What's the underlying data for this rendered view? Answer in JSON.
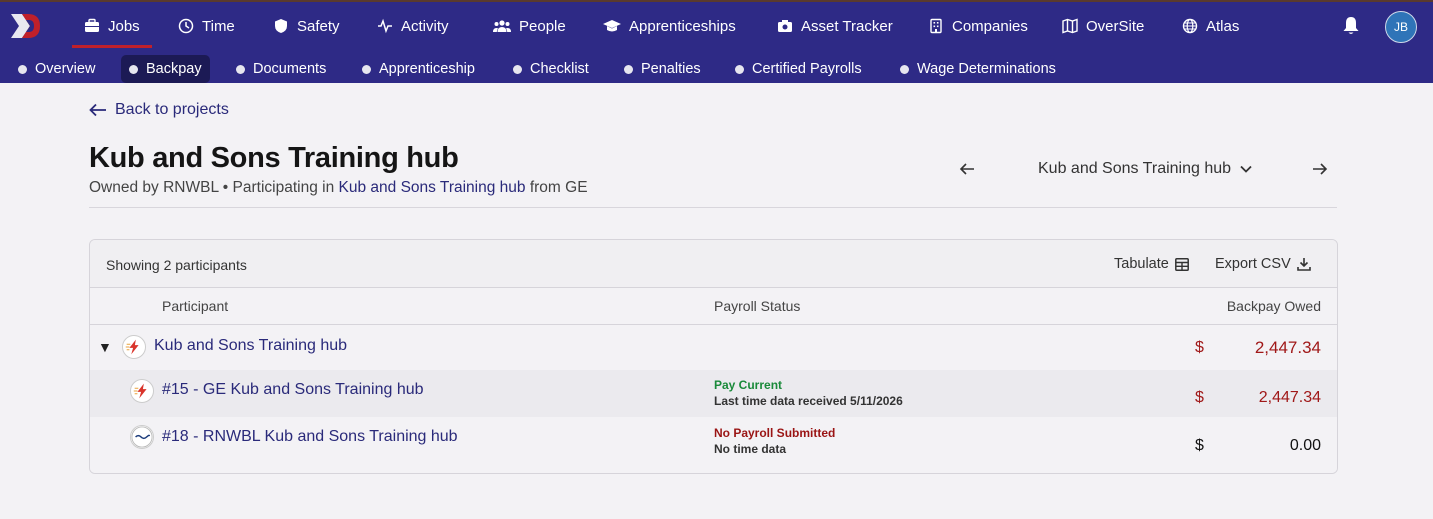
{
  "nav": {
    "items": [
      {
        "label": "Jobs",
        "icon": "briefcase-icon"
      },
      {
        "label": "Time",
        "icon": "clock-icon"
      },
      {
        "label": "Safety",
        "icon": "shield-icon"
      },
      {
        "label": "Activity",
        "icon": "pulse-icon"
      },
      {
        "label": "People",
        "icon": "people-icon"
      },
      {
        "label": "Apprenticeships",
        "icon": "graduation-cap-icon"
      },
      {
        "label": "Asset Tracker",
        "icon": "camera-icon"
      },
      {
        "label": "Companies",
        "icon": "building-icon"
      },
      {
        "label": "OverSite",
        "icon": "map-icon"
      },
      {
        "label": "Atlas",
        "icon": "globe-icon"
      }
    ],
    "avatar": "JB"
  },
  "subnav": {
    "items": [
      "Overview",
      "Backpay",
      "Documents",
      "Apprenticeship",
      "Checklist",
      "Penalties",
      "Certified Payrolls",
      "Wage Determinations"
    ]
  },
  "page": {
    "back": "Back to projects",
    "title": "Kub and Sons Training hub",
    "owned_prefix": "Owned by RNWBL • Participating in",
    "owned_link": "Kub and Sons Training hub",
    "owned_suffix": "from GE",
    "project_selector": "Kub and Sons Training hub"
  },
  "table": {
    "showing": "Showing 2 participants",
    "tabulate": "Tabulate",
    "export": "Export CSV",
    "headers": {
      "participant": "Participant",
      "payroll_status": "Payroll Status",
      "backpay_owed": "Backpay Owed"
    },
    "group": {
      "name": "Kub and Sons Training hub",
      "currency": "$",
      "amount": "2,447.34"
    },
    "rows": [
      {
        "name": "#15 - GE Kub and Sons Training hub",
        "status": "Pay Current",
        "status_detail": "Last time data received 5/11/2026",
        "currency": "$",
        "amount": "2,447.34"
      },
      {
        "name": "#18 - RNWBL Kub and Sons Training hub",
        "status": "No Payroll Submitted",
        "status_detail": "No time data",
        "currency": "$",
        "amount": "0.00"
      }
    ]
  },
  "colors": {
    "nav_bg": "#2e2a86",
    "accent_red": "#c0202a",
    "amount_red": "#a01818",
    "status_green": "#1a8a3a"
  }
}
